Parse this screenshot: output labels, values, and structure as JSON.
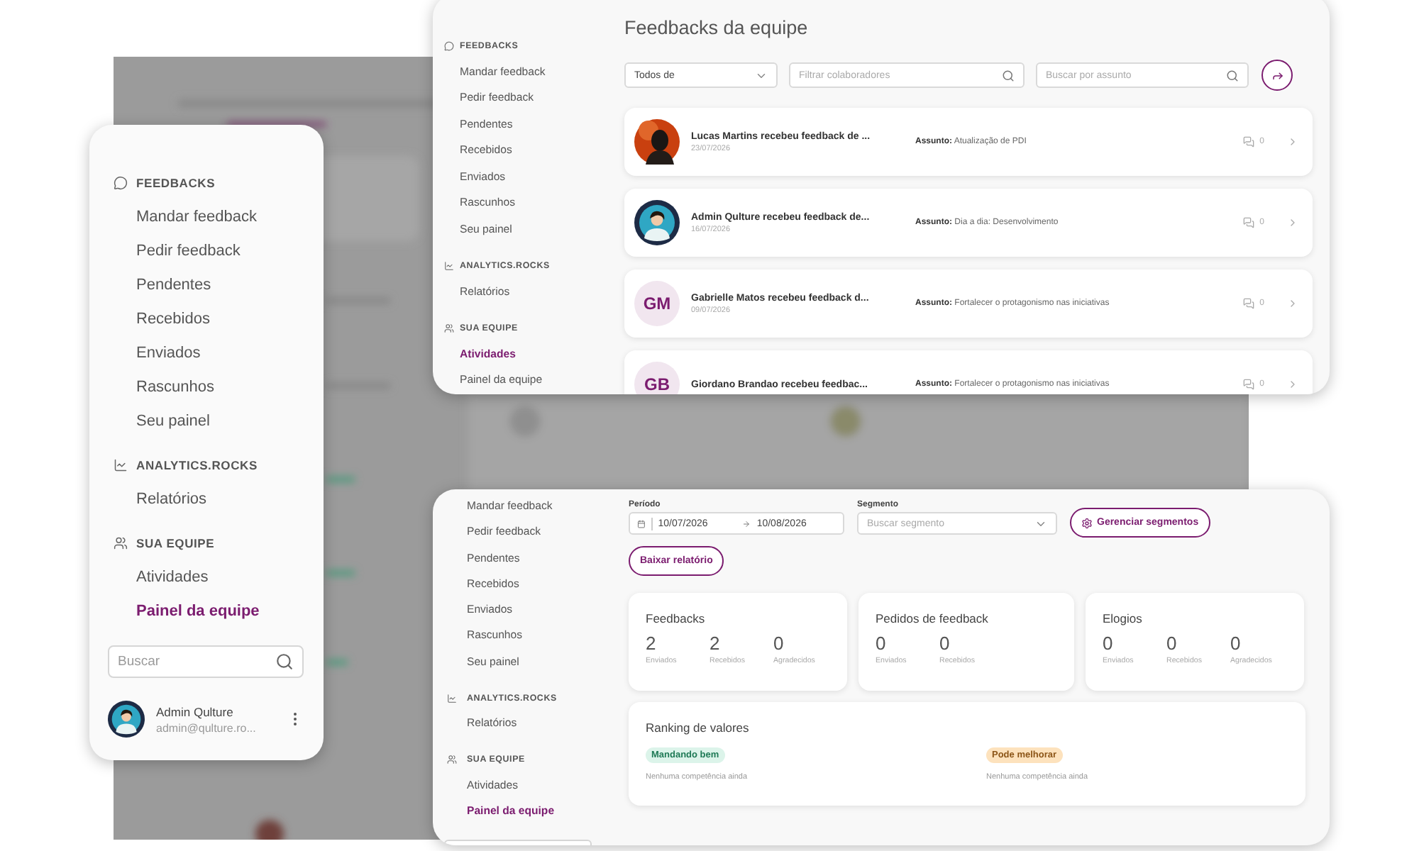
{
  "sidebar_panel": {
    "sections": [
      {
        "kind": "feedbacks",
        "title": "FEEDBACKS",
        "items": [
          {
            "label": "Mandar feedback",
            "selected": false
          },
          {
            "label": "Pedir feedback",
            "selected": false
          },
          {
            "label": "Pendentes",
            "selected": false
          },
          {
            "label": "Recebidos",
            "selected": false
          },
          {
            "label": "Enviados",
            "selected": false
          },
          {
            "label": "Rascunhos",
            "selected": false
          },
          {
            "label": "Seu painel",
            "selected": false
          }
        ]
      },
      {
        "kind": "analytics",
        "title": "ANALYTICS.ROCKS",
        "items": [
          {
            "label": "Relatórios",
            "selected": false
          }
        ]
      },
      {
        "kind": "team",
        "title": "SUA EQUIPE",
        "items": [
          {
            "label": "Atividades",
            "selected": false
          },
          {
            "label": "Painel da equipe",
            "selected": true
          }
        ]
      }
    ],
    "search": {
      "placeholder": "Buscar"
    },
    "user": {
      "name": "Admin Qulture",
      "email": "admin@qulture.ro..."
    }
  },
  "feedbacks_panel": {
    "sidebar": {
      "sections": [
        {
          "kind": "feedbacks",
          "title": "FEEDBACKS",
          "items": [
            {
              "label": "Mandar feedback",
              "selected": false
            },
            {
              "label": "Pedir feedback",
              "selected": false
            },
            {
              "label": "Pendentes",
              "selected": false
            },
            {
              "label": "Recebidos",
              "selected": false
            },
            {
              "label": "Enviados",
              "selected": false
            },
            {
              "label": "Rascunhos",
              "selected": false
            },
            {
              "label": "Seu painel",
              "selected": false
            }
          ]
        },
        {
          "kind": "analytics",
          "title": "ANALYTICS.ROCKS",
          "items": [
            {
              "label": "Relatórios",
              "selected": false
            }
          ]
        },
        {
          "kind": "team",
          "title": "SUA EQUIPE",
          "items": [
            {
              "label": "Atividades",
              "selected": true
            },
            {
              "label": "Painel da equipe",
              "selected": false
            }
          ]
        }
      ]
    },
    "title": "Feedbacks da equipe",
    "filters": {
      "select": "Todos de",
      "collaborator_placeholder": "Filtrar colaboradores",
      "subject_placeholder": "Buscar por assunto"
    },
    "feedbacks": [
      {
        "title": "Lucas Martins recebeu feedback de ...",
        "date": "23/07/2026",
        "subject_label": "Assunto:",
        "subject": "Atualização de PDI",
        "comments": "0"
      },
      {
        "title": "Admin Qulture recebeu feedback de...",
        "date": "16/07/2026",
        "subject_label": "Assunto:",
        "subject": "Dia a dia: Desenvolvimento",
        "comments": "0"
      },
      {
        "avatar": {
          "kind": "initials",
          "initials": "GM"
        },
        "title": "Gabrielle Matos recebeu feedback d...",
        "date": "09/07/2026",
        "subject_label": "Assunto:",
        "subject": "Fortalecer o protagonismo nas iniciativas",
        "comments": "0"
      },
      {
        "avatar": {
          "kind": "initials",
          "initials": "GB"
        },
        "title": "Giordano Brandao recebeu feedbac...",
        "subject_label": "Assunto:",
        "subject": "Fortalecer o protagonismo nas iniciativas",
        "comments": "0"
      }
    ]
  },
  "dashboard_panel": {
    "sidebar": {
      "sections": [
        {
          "items": [
            {
              "label": "Mandar feedback",
              "selected": false
            },
            {
              "label": "Pedir feedback",
              "selected": false
            },
            {
              "label": "Pendentes",
              "selected": false
            },
            {
              "label": "Recebidos",
              "selected": false
            },
            {
              "label": "Enviados",
              "selected": false
            },
            {
              "label": "Rascunhos",
              "selected": false
            },
            {
              "label": "Seu painel",
              "selected": false
            }
          ]
        },
        {
          "kind": "analytics",
          "title": "ANALYTICS.ROCKS",
          "items": [
            {
              "label": "Relatórios",
              "selected": false
            }
          ]
        },
        {
          "kind": "team",
          "title": "SUA EQUIPE",
          "items": [
            {
              "label": "Atividades",
              "selected": false
            },
            {
              "label": "Painel da equipe",
              "selected": true
            }
          ]
        }
      ]
    },
    "period": {
      "label": "Período",
      "start": "10/07/2026",
      "end": "10/08/2026"
    },
    "segment": {
      "label": "Segmento",
      "placeholder": "Buscar segmento"
    },
    "manage_button": "Gerenciar segmentos",
    "report_button": "Baixar relatório",
    "stats": [
      {
        "title": "Feedbacks",
        "metrics": [
          {
            "value": "2",
            "label": "Enviados"
          },
          {
            "value": "2",
            "label": "Recebidos"
          },
          {
            "value": "0",
            "label": "Agradecidos"
          }
        ]
      },
      {
        "title": "Pedidos de feedback",
        "metrics": [
          {
            "value": "0",
            "label": "Enviados"
          },
          {
            "value": "0",
            "label": "Recebidos"
          }
        ]
      },
      {
        "title": "Elogios",
        "metrics": [
          {
            "value": "0",
            "label": "Enviados"
          },
          {
            "value": "0",
            "label": "Recebidos"
          },
          {
            "value": "0",
            "label": "Agradecidos"
          }
        ]
      }
    ],
    "ranking": {
      "title": "Ranking de valores",
      "groups": [
        {
          "kind": "good",
          "label": "Mandando bem",
          "empty": "Nenhuma competência ainda"
        },
        {
          "kind": "improve",
          "label": "Pode melhorar",
          "empty": "Nenhuma competência ainda"
        }
      ]
    }
  }
}
